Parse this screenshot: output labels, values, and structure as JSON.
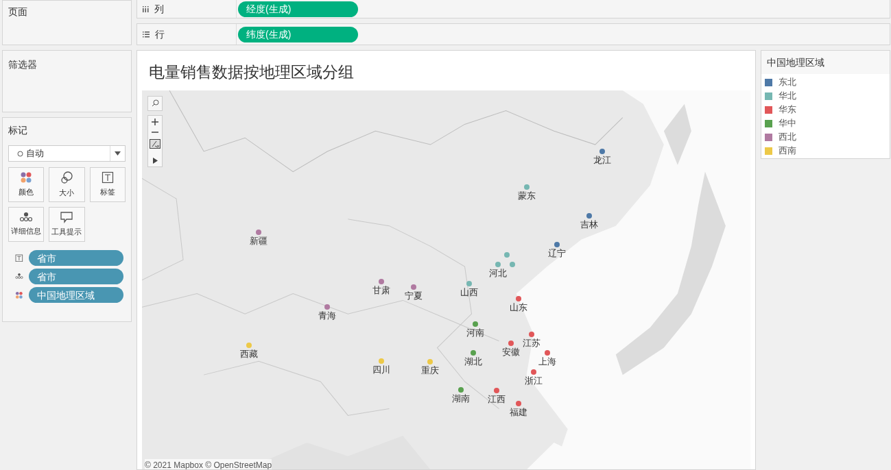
{
  "pages_shelf": {
    "title": "页面"
  },
  "filters_shelf": {
    "title": "筛选器"
  },
  "marks": {
    "title": "标记",
    "mark_type": "自动",
    "buttons": [
      {
        "kind": "color",
        "label": "颜色"
      },
      {
        "kind": "size",
        "label": "大小"
      },
      {
        "kind": "label",
        "label": "标签"
      },
      {
        "kind": "detail",
        "label": "详细信息"
      },
      {
        "kind": "tooltip",
        "label": "工具提示"
      }
    ],
    "fields": [
      {
        "kind": "label",
        "name": "省市"
      },
      {
        "kind": "detail",
        "name": "省市"
      },
      {
        "kind": "color",
        "name": "中国地理区域"
      }
    ]
  },
  "columns_shelf": {
    "label": "列",
    "pill": "经度(生成)"
  },
  "rows_shelf": {
    "label": "行",
    "pill": "纬度(生成)"
  },
  "view": {
    "title": "电量销售数据按地理区域分组",
    "attribution": "© 2021 Mapbox © OpenStreetMap",
    "points": [
      {
        "label": "龙江",
        "color": "#4e79a7"
      },
      {
        "label": "蒙东",
        "color": "#76b7b2"
      },
      {
        "label": "吉林",
        "color": "#4e79a7"
      },
      {
        "label": "新疆",
        "color": "#b07aa1"
      },
      {
        "label": "辽宁",
        "color": "#4e79a7"
      },
      {
        "color": "#76b7b2"
      },
      {
        "color": "#76b7b2"
      },
      {
        "label": "河北",
        "color": "#76b7b2"
      },
      {
        "label": "甘肃",
        "color": "#b07aa1"
      },
      {
        "label": "宁夏",
        "color": "#b07aa1"
      },
      {
        "label": "山西",
        "color": "#76b7b2"
      },
      {
        "label": "山东",
        "color": "#e15759"
      },
      {
        "label": "青海",
        "color": "#b07aa1"
      },
      {
        "label": "河南",
        "color": "#59a14f"
      },
      {
        "label": "江苏",
        "color": "#e15759"
      },
      {
        "label": "安徽",
        "color": "#e15759"
      },
      {
        "label": "西藏",
        "color": "#edc948"
      },
      {
        "label": "湖北",
        "color": "#59a14f"
      },
      {
        "label": "上海",
        "color": "#e15759"
      },
      {
        "label": "四川",
        "color": "#edc948"
      },
      {
        "label": "重庆",
        "color": "#edc948"
      },
      {
        "label": "浙江",
        "color": "#e15759"
      },
      {
        "label": "湖南",
        "color": "#59a14f"
      },
      {
        "label": "江西",
        "color": "#e15759"
      },
      {
        "label": "福建",
        "color": "#e15759"
      }
    ]
  },
  "legend": {
    "title": "中国地理区域",
    "items": [
      {
        "label": "东北",
        "color": "#4e79a7"
      },
      {
        "label": "华北",
        "color": "#76b7b2"
      },
      {
        "label": "华东",
        "color": "#e15759"
      },
      {
        "label": "华中",
        "color": "#59a14f"
      },
      {
        "label": "西北",
        "color": "#b07aa1"
      },
      {
        "label": "西南",
        "color": "#edc948"
      }
    ]
  }
}
